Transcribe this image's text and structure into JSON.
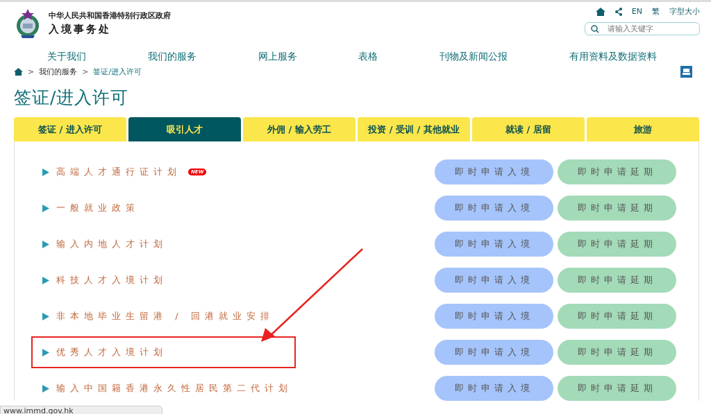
{
  "header": {
    "government": "中华人民共和国香港特别行政区政府",
    "department": "入境事务处",
    "utility_links": [
      "EN",
      "繁",
      "字型大小"
    ],
    "search": {
      "placeholder": "请输入关键字"
    }
  },
  "nav": [
    "关于我们",
    "我们的服务",
    "网上服务",
    "表格",
    "刊物及新闻公报",
    "有用资料及数据资料"
  ],
  "breadcrumb": [
    {
      "separator": ">",
      "label": "我们的服务",
      "current": false
    },
    {
      "separator": ">",
      "label": "签证/进入许可",
      "current": true
    }
  ],
  "page_title": "签证/进入许可",
  "tabs": [
    {
      "label": "签证 / 进入许可",
      "selected": false
    },
    {
      "label": "吸引人才",
      "selected": true
    },
    {
      "label": "外佣 / 输入劳工",
      "selected": false
    },
    {
      "label": "投资 / 受训 / 其他就业",
      "selected": false
    },
    {
      "label": "就读 / 居留",
      "selected": false
    },
    {
      "label": "旅游",
      "selected": false
    }
  ],
  "schemes": [
    {
      "name": "高端人才通行证计划",
      "badge": "NEW",
      "highlighted": false,
      "apply_button": "即时申请入境",
      "extend_button": "即时申请延期"
    },
    {
      "name": "一般就业政策",
      "highlighted": false,
      "apply_button": "即时申请入境",
      "extend_button": "即时申请延期"
    },
    {
      "name": "输入内地人才计划",
      "highlighted": false,
      "apply_button": "即时申请入境",
      "extend_button": "即时申请延期"
    },
    {
      "name": "科技人才入境计划",
      "highlighted": false,
      "apply_button": "即时申请入境",
      "extend_button": "即时申请延期"
    },
    {
      "name": "非本地毕业生留港 / 回港就业安排",
      "highlighted": false,
      "apply_button": "即时申请入境",
      "extend_button": "即时申请延期"
    },
    {
      "name": "优秀人才入境计划",
      "highlighted": true,
      "apply_button": "即时申请入境",
      "extend_button": "即时申请延期"
    },
    {
      "name": "输入中国籍香港永久性居民第二代计划",
      "highlighted": false,
      "apply_button": "即时申请入境",
      "extend_button": "即时申请延期"
    }
  ],
  "status_bar": "www.immd.gov.hk"
}
